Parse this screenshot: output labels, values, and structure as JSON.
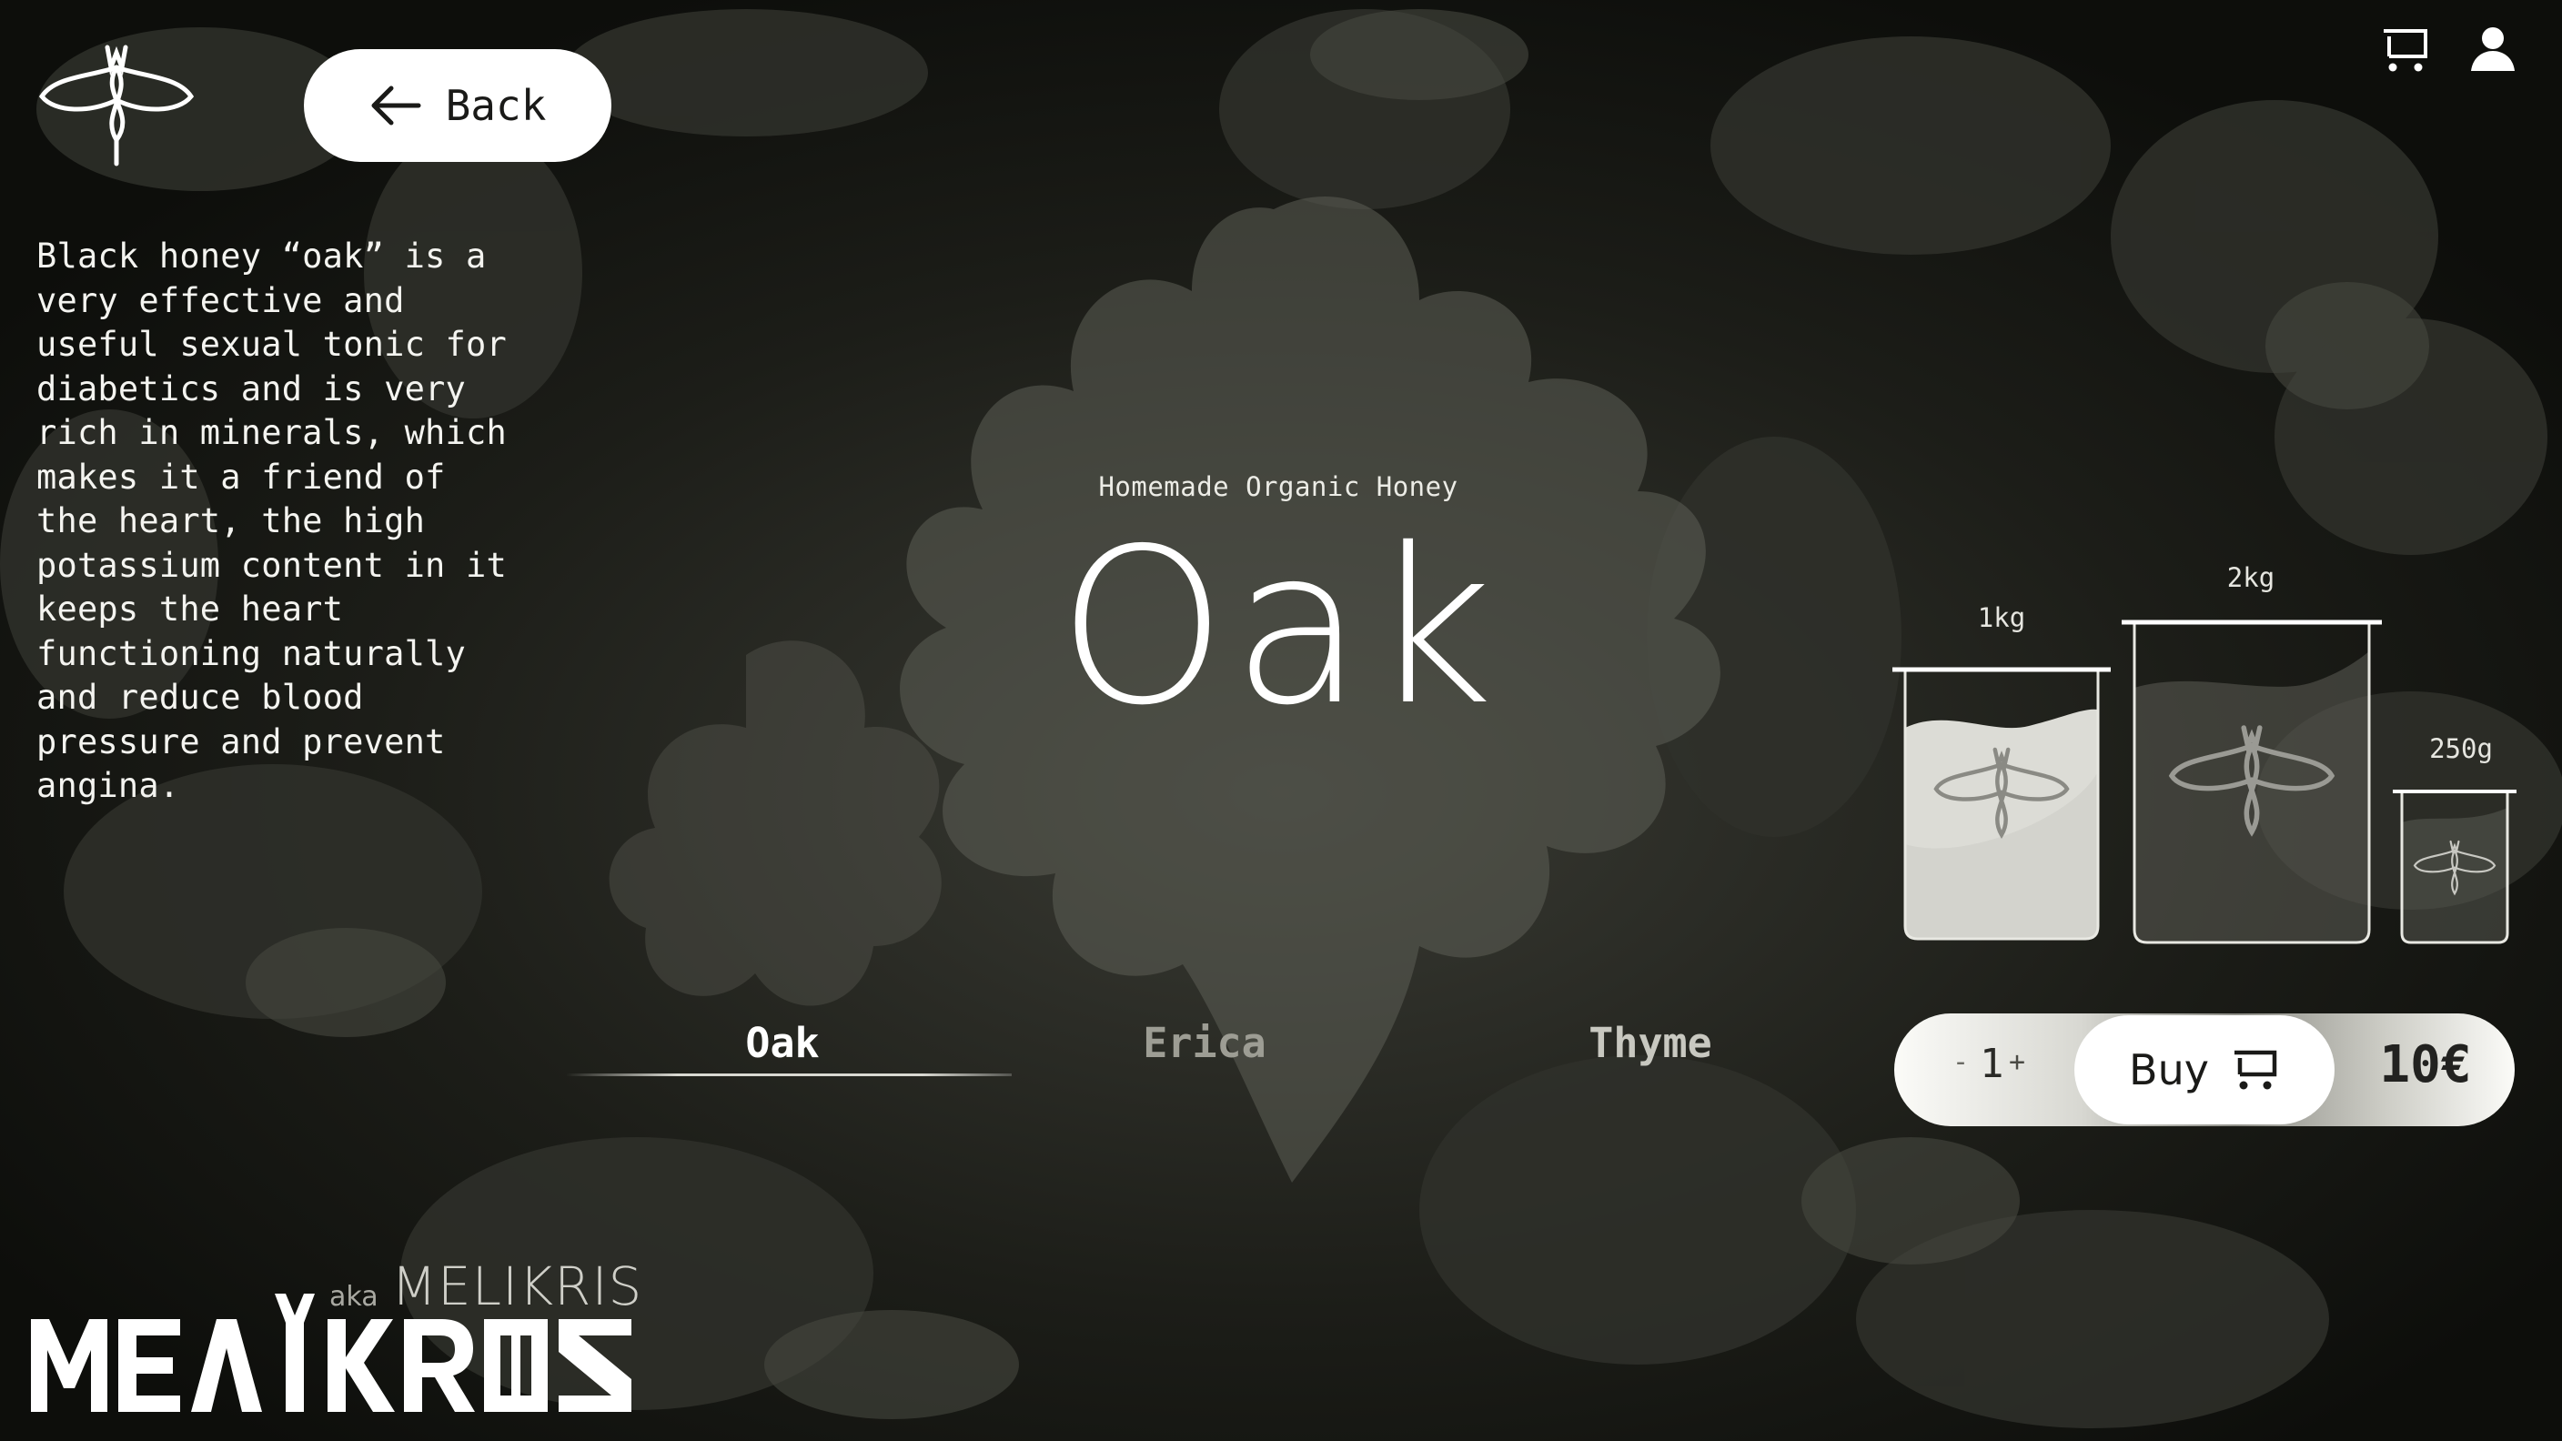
{
  "header": {
    "back_label": "Back",
    "icons": [
      "logo-icon",
      "cart-icon",
      "user-icon"
    ]
  },
  "product": {
    "description": "Black honey “oak” is a\nvery effective and\nuseful sexual tonic for\ndiabetics and is very\nrich in minerals, which\nmakes it a friend of\nthe heart, the high\npotassium content in it\nkeeps the heart\nfunctioning naturally\nand reduce blood\npressure and prevent\nangina.",
    "subtitle": "Homemade Organic Honey",
    "title": "Oak"
  },
  "sizes": [
    {
      "label": "1kg"
    },
    {
      "label": "2kg"
    },
    {
      "label": "250g"
    }
  ],
  "tabs": [
    {
      "label": "Oak",
      "active": true
    },
    {
      "label": "Erica",
      "active": false
    },
    {
      "label": "Thyme",
      "active": false
    }
  ],
  "purchase": {
    "minus": "-",
    "quantity": "1",
    "plus": "+",
    "buy_label": "Buy",
    "price": "10€"
  },
  "brand": {
    "aka": "aka",
    "aka_name": "MELIKRIS",
    "wordmark": "MEΛIKRIS"
  },
  "colors": {
    "background": "#0f100d",
    "text": "#ffffff",
    "muted_tab": "#9d9d94",
    "button_bg": "#ffffff"
  }
}
